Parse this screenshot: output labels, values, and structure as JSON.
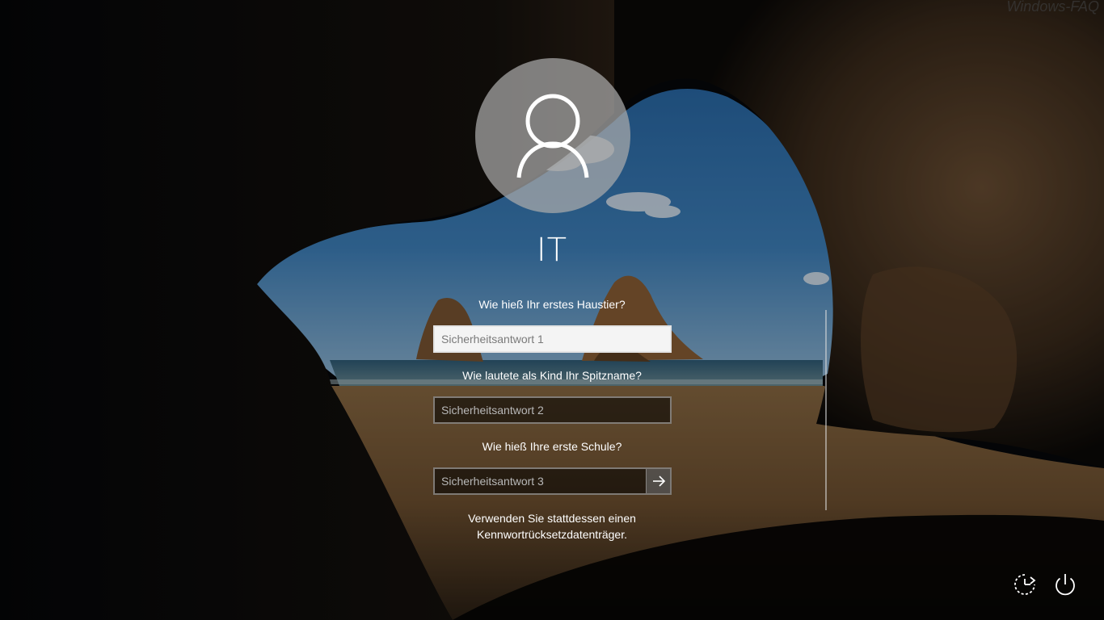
{
  "watermark": "Windows-FAQ",
  "user": {
    "name": "IT"
  },
  "security_questions": [
    {
      "question": "Wie hieß Ihr erstes Haustier?",
      "placeholder": "Sicherheitsantwort 1",
      "value": ""
    },
    {
      "question": "Wie lautete als Kind Ihr Spitzname?",
      "placeholder": "Sicherheitsantwort 2",
      "value": ""
    },
    {
      "question": "Wie hieß Ihre erste Schule?",
      "placeholder": "Sicherheitsantwort 3",
      "value": ""
    }
  ],
  "submit": {
    "icon": "arrow-right-icon"
  },
  "reset_disk_link": {
    "line1": "Verwenden Sie stattdessen einen",
    "line2": "Kennwortrücksetzdatenträger."
  },
  "corner_buttons": {
    "accessibility_icon": "ease-of-access-icon",
    "power_icon": "power-icon"
  },
  "colors": {
    "text": "#ffffff",
    "field_border": "#c8c8c8",
    "focused_field_bg": "#f4f4f4"
  }
}
